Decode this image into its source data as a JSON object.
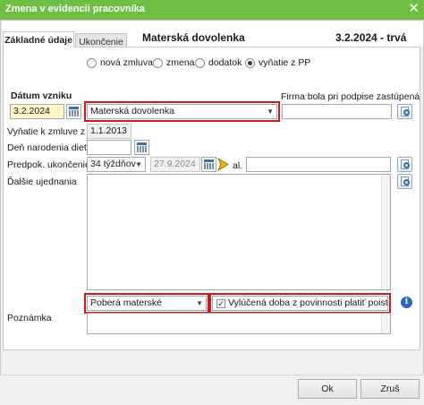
{
  "window": {
    "title": "Zmena v evidencii pracovníka",
    "close_glyph": "✕"
  },
  "header": {
    "title": "Materská dovolenka",
    "period": "3.2.2024 - trvá"
  },
  "tabs": [
    {
      "label": "Základné údaje",
      "active": true
    },
    {
      "label": "Ukončenie",
      "active": false
    }
  ],
  "radios": [
    {
      "label": "nová zmluva",
      "selected": false
    },
    {
      "label": "zmena",
      "selected": false
    },
    {
      "label": "dodatok",
      "selected": false
    },
    {
      "label": "vyňatie z PP",
      "selected": true
    }
  ],
  "form": {
    "datum_vzniku_label": "Dátum vzniku",
    "datum_vzniku_value": "3.2.2024",
    "typ_value": "Materská dovolenka",
    "firma_label": "Firma bola pri podpise zastúpená",
    "firma_value": "",
    "vynatie_label": "Vyňatie k zmluve z",
    "vynatie_value": "1.1.2013",
    "den_narodenia_label": "Deň narodenia dieťaťa",
    "den_narodenia_value": "",
    "predpok_label": "Predpok. ukončenie",
    "predpok_weeks": "34 týždňov",
    "predpok_date": "27.9.2024",
    "al_label": "al.",
    "al_value": "",
    "dalsie_label": "Ďalšie ujednania",
    "poberal_value": "Poberá materské",
    "vylucena_label": "Vylúčená doba z povinnosti platiť poistné na SP",
    "vylucena_checked": true,
    "poznamka_label": "Poznámka"
  },
  "buttons": {
    "ok": "Ok",
    "close": "Zruš"
  },
  "icons": {
    "calendar": "calendar-icon",
    "search": "search-document-icon",
    "arrow": "arrow-icon",
    "info": "info-icon"
  },
  "colors": {
    "titlebar": "#6fbf45",
    "highlight": "#d21a1a",
    "date_field": "#fff6c6",
    "info": "#2b64c8"
  }
}
